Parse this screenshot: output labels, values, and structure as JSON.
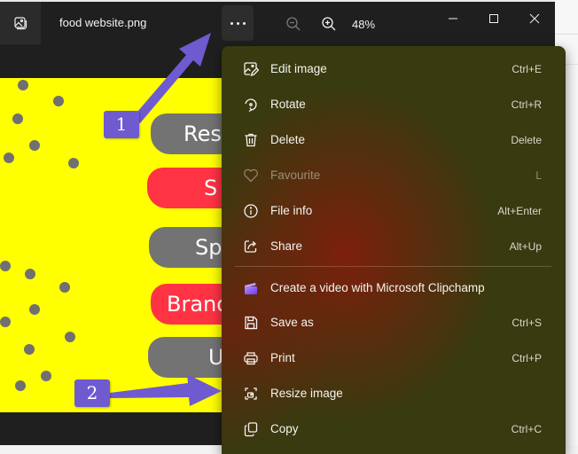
{
  "window": {
    "file_name": "food website.png",
    "zoom_level": "48%",
    "icons": {
      "app": "photo-icon",
      "more": "more-horizontal-icon",
      "zoom_out": "zoom-out-icon",
      "zoom_in": "zoom-in-icon",
      "minimize": "minimize-icon",
      "maximize": "maximize-icon",
      "close": "close-icon"
    }
  },
  "poster": {
    "background": "#ffff00",
    "pills": [
      {
        "text": "Res",
        "color": "gray"
      },
      {
        "text": "S",
        "color": "red"
      },
      {
        "text": "Sp",
        "color": "gray"
      },
      {
        "text": "Brand",
        "color": "red"
      },
      {
        "text": "U",
        "color": "gray"
      }
    ]
  },
  "annotations": {
    "callout_1": "1",
    "callout_2": "2",
    "arrow_color": "#6f5ad0"
  },
  "menu": {
    "items": [
      {
        "label": "Edit image",
        "shortcut": "Ctrl+E",
        "icon": "edit-image-icon",
        "disabled": false
      },
      {
        "label": "Rotate",
        "shortcut": "Ctrl+R",
        "icon": "rotate-icon",
        "disabled": false
      },
      {
        "label": "Delete",
        "shortcut": "Delete",
        "icon": "trash-icon",
        "disabled": false
      },
      {
        "label": "Favourite",
        "shortcut": "L",
        "icon": "heart-icon",
        "disabled": true
      },
      {
        "label": "File info",
        "shortcut": "Alt+Enter",
        "icon": "info-icon",
        "disabled": false
      },
      {
        "label": "Share",
        "shortcut": "Alt+Up",
        "icon": "share-icon",
        "disabled": false
      },
      {
        "label": "Create a video with Microsoft Clipchamp",
        "shortcut": "",
        "icon": "clipchamp-icon",
        "disabled": false
      },
      {
        "label": "Save as",
        "shortcut": "Ctrl+S",
        "icon": "save-icon",
        "disabled": false
      },
      {
        "label": "Print",
        "shortcut": "Ctrl+P",
        "icon": "print-icon",
        "disabled": false
      },
      {
        "label": "Resize image",
        "shortcut": "",
        "icon": "resize-image-icon",
        "disabled": false
      },
      {
        "label": "Copy",
        "shortcut": "Ctrl+C",
        "icon": "copy-icon",
        "disabled": false
      }
    ]
  }
}
